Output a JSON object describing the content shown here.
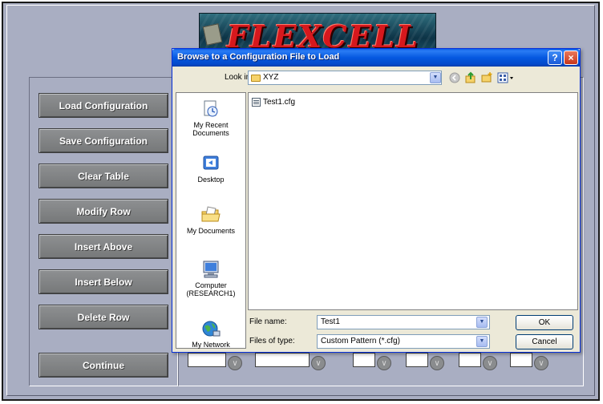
{
  "app": {
    "logo_text": "FLEXCELL",
    "buttons": [
      {
        "id": "load",
        "label": "Load Configuration"
      },
      {
        "id": "save",
        "label": "Save Configuration"
      },
      {
        "id": "clear",
        "label": "Clear Table"
      },
      {
        "id": "modify",
        "label": "Modify Row"
      },
      {
        "id": "insert_above",
        "label": "Insert Above"
      },
      {
        "id": "insert_below",
        "label": "Insert Below"
      },
      {
        "id": "delete",
        "label": "Delete Row"
      },
      {
        "id": "continue",
        "label": "Continue"
      }
    ]
  },
  "dialog": {
    "title": "Browse to a Configuration File to Load",
    "help_icon": "?",
    "close_icon": "×",
    "look_in_label": "Look in:",
    "look_in_value": "XYZ",
    "places": [
      {
        "label_line1": "My Recent",
        "label_line2": "Documents",
        "icon": "recent-documents-icon"
      },
      {
        "label_line1": "Desktop",
        "label_line2": "",
        "icon": "desktop-icon"
      },
      {
        "label_line1": "My Documents",
        "label_line2": "",
        "icon": "my-documents-icon"
      },
      {
        "label_line1": "Computer",
        "label_line2": "(RESEARCH1)",
        "icon": "computer-icon"
      },
      {
        "label_line1": "My Network",
        "label_line2": "",
        "icon": "network-icon"
      }
    ],
    "files": [
      {
        "name": "Test1.cfg",
        "icon": "cfg-file-icon"
      }
    ],
    "file_name_label": "File name:",
    "file_name_value": "Test1",
    "file_type_label": "Files of type:",
    "file_type_value": "Custom Pattern (*.cfg)",
    "ok_label": "OK",
    "cancel_label": "Cancel"
  }
}
